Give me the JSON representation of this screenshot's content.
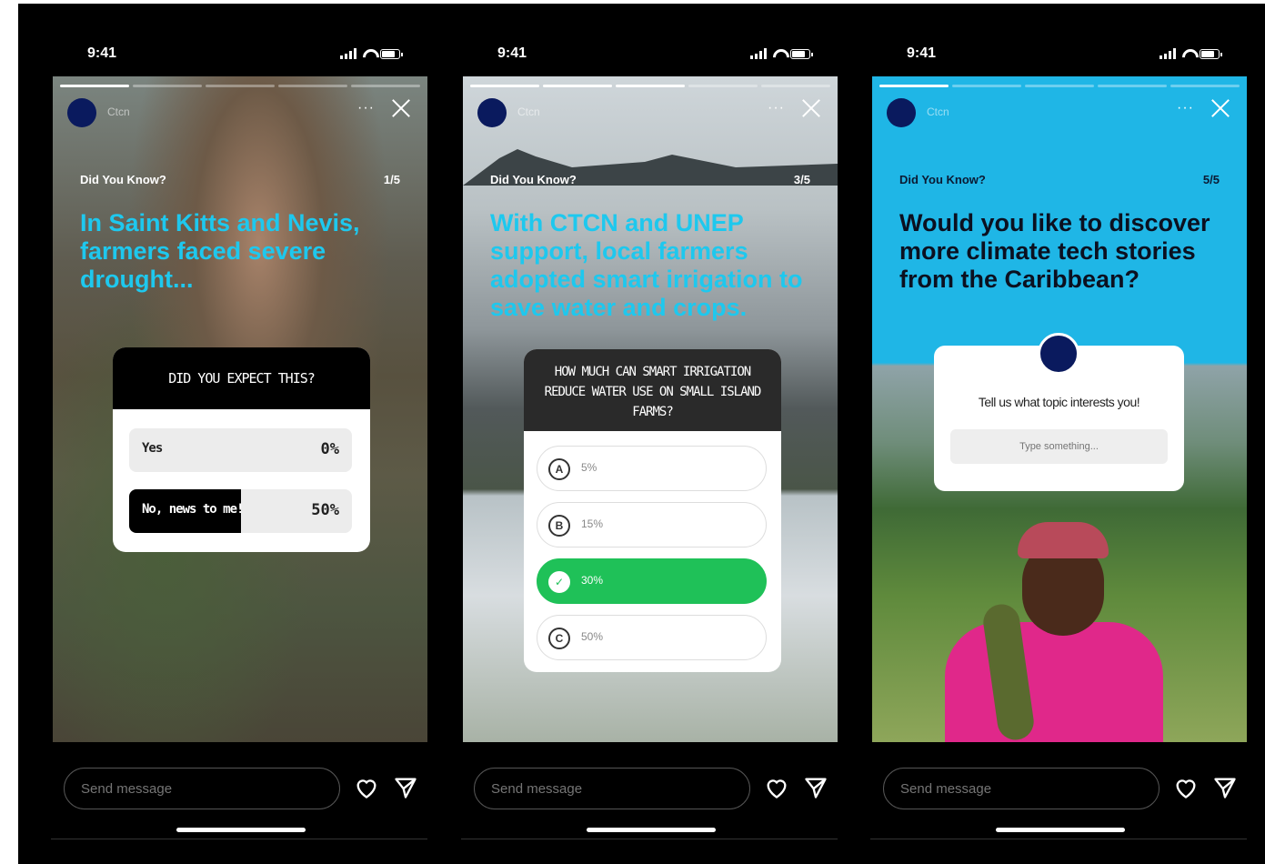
{
  "status": {
    "time": "9:41"
  },
  "stories": [
    {
      "user": "Ctcn",
      "eyebrow": "Did You Know?",
      "page": "1/5",
      "headline": "In Saint Kitts and Nevis, farmers faced severe drought...",
      "poll": {
        "question": "DID YOU EXPECT THIS?",
        "options": [
          {
            "label": "Yes",
            "percent": "0%",
            "value": 0
          },
          {
            "label": "No, news to me!",
            "percent": "50%",
            "value": 50
          }
        ]
      }
    },
    {
      "user": "Ctcn",
      "eyebrow": "Did You Know?",
      "page": "3/5",
      "headline": "With CTCN and UNEP support, local farmers adopted smart irrigation to save water and crops.",
      "quiz": {
        "question": "HOW MUCH CAN SMART IRRIGATION REDUCE WATER USE ON SMALL ISLAND FARMS?",
        "options": [
          {
            "key": "A",
            "label": "5%"
          },
          {
            "key": "B",
            "label": "15%"
          },
          {
            "key": "✓",
            "label": "30%",
            "correct": true
          },
          {
            "key": "C",
            "label": "50%"
          }
        ]
      }
    },
    {
      "user": "Ctcn",
      "eyebrow": "Did You Know?",
      "page": "5/5",
      "headline": "Would you like to discover more climate tech stories from the Caribbean?",
      "question_box": {
        "prompt": "Tell us what topic interests you!",
        "placeholder": "Type something..."
      }
    }
  ],
  "footer": {
    "send_placeholder": "Send message"
  },
  "colors": {
    "accent": "#1ec8ee",
    "correct": "#1fc158",
    "brand": "#0a1a5e"
  }
}
